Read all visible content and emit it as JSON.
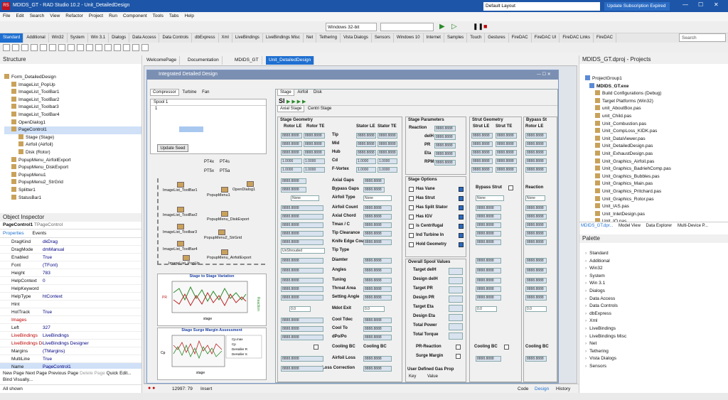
{
  "window": {
    "title": "MDIDS_GT - RAD Studio 10.2 - Unit_DetailedDesign",
    "layout": "Default Layout",
    "update": "Update Subscription Expired"
  },
  "menu": [
    "File",
    "Edit",
    "Search",
    "View",
    "Refactor",
    "Project",
    "Run",
    "Component",
    "Tools",
    "Tabs",
    "Help"
  ],
  "toolbar": {
    "platform": "Windows 32-bit",
    "search_placeholder": "Search"
  },
  "palette_tabs": [
    "Standard",
    "Additional",
    "Win32",
    "System",
    "Win 3.1",
    "Dialogs",
    "Data Access",
    "Data Controls",
    "dbExpress",
    "Xml",
    "LiveBindings",
    "LiveBindings Misc",
    "Net",
    "Tethering",
    "Vista Dialogs",
    "Sensors",
    "Windows 10",
    "Internet",
    "Samples",
    "Touch",
    "Gestures",
    "FireDAC",
    "FireDAC UI",
    "FireDAC Links",
    "FireDAC"
  ],
  "structure": {
    "title": "Structure",
    "items": [
      "Form_DetailedDesign",
      "ImageList_PopUp",
      "ImageList_ToolBar1",
      "ImageList_ToolBar2",
      "ImageList_Toolbar3",
      "ImageList_ToolBar4",
      "OpenDialog1",
      "PageControl1",
      "Stage (Stage)",
      "Airfoil (Airfoil)",
      "Disk (Rotor)",
      "PopupMenu_AirfoilExport",
      "PopupMenu_DiskExport",
      "PopupMenu1",
      "PopupMenu2_StrGrid",
      "Splitter1",
      "StatusBar1"
    ]
  },
  "object_inspector": {
    "title": "Object Inspector",
    "selected": "PageControl1",
    "selected_type": "TPageControl",
    "tabs": [
      "Properties",
      "Events"
    ],
    "rows": [
      [
        "DragKind",
        "dkDrag"
      ],
      [
        "DragMode",
        "dmManual"
      ],
      [
        "Enabled",
        "True"
      ],
      [
        "Font",
        "(TFont)"
      ],
      [
        "Height",
        "783"
      ],
      [
        "HelpContext",
        "0"
      ],
      [
        "HelpKeyword",
        ""
      ],
      [
        "HelpType",
        "htContext"
      ],
      [
        "Hint",
        ""
      ],
      [
        "HotTrack",
        "True"
      ],
      [
        "Images",
        ""
      ],
      [
        "Left",
        "327"
      ],
      [
        "LiveBindings",
        "LiveBindings"
      ],
      [
        "LiveBindings Des",
        "LiveBindings Designer"
      ],
      [
        "Margins",
        "(TMargins)"
      ],
      [
        "MultiLine",
        "True"
      ],
      [
        "Name",
        "PageControl1"
      ],
      [
        "OwnerDraw",
        "False"
      ]
    ],
    "links": [
      "New Page",
      "Next Page",
      "Previous Page",
      "Delete Page",
      "Quick Edit...",
      "Bind Visually..."
    ],
    "footer": "All shown"
  },
  "doc_tabs": [
    "WelcomePage",
    "Documentation",
    "MDIDS_GT",
    "Unit_DetailedDesign"
  ],
  "form": {
    "title": "Integrated Detailed Design",
    "left_tabs": [
      "Compressor",
      "Turbine",
      "Fan"
    ],
    "spool_tab": "Spool 1",
    "spool_cell": "1",
    "update_btn": "Update Seed",
    "pt_labels": [
      "PT4x",
      "PT4s",
      "PT5x",
      "PT5a"
    ],
    "components": [
      "ImageList_ToolBar1",
      "PopupMenu1",
      "OpenDialog1",
      "ImageList_ToolBar2",
      "PopupMenu_DiskExport",
      "ImageList_Toolbar3",
      "PopupMenu2_StrGrid",
      "ImageList_ToolBar4",
      "PopupMenu_AirfoilExport",
      "ImageList_PopUp"
    ],
    "chart1": {
      "title": "Stage to Stage Variation",
      "xlabel": "stage",
      "ylabel": "PR",
      "y2label": "Reaction"
    },
    "chart2": {
      "title": "Stage Surge Margin Assessment",
      "xlabel": "stage",
      "ylabel": "Cp",
      "legend": [
        "Cp.max",
        "Cp",
        "DeHaller R",
        "DeHaller S"
      ]
    },
    "stage_tabs": [
      "Stage",
      "Airfoil",
      "Disk"
    ],
    "sub_tabs": [
      "Axial Stage",
      "Centri Stage"
    ],
    "stage_geometry": {
      "title": "Stage Geometry",
      "cols": [
        "Rotor LE",
        "Rotor TE",
        "Stator LE",
        "Stator TE"
      ],
      "rows": [
        "Tip",
        "Mid",
        "Hub",
        "Cd",
        "F-Vortex",
        "Axial Gaps",
        "Bypass Gaps",
        "Airfoil Type",
        "Airfoil Count",
        "Axial Chord",
        "Tmax / C",
        "Tip Clearance",
        "Knife Edge Count",
        "Tip Type",
        "Diamter",
        "Angles",
        "Tuning",
        "Throat Area",
        "Setting Angle",
        "Mdot Exit",
        "Cool Tdec",
        "Cool To",
        "dPo/Po",
        "Cooling BC",
        "Airfoil Loss",
        "Loss Correction"
      ],
      "val": "8888.8888",
      "val1": "1.0000",
      "none": "None",
      "unshrouded": "UnShrouded",
      "zero": "0.0",
      "cool_bc": "Cooling BC"
    },
    "stage_params": {
      "title": "Stage Parameters",
      "rows": [
        "Reaction",
        "delH",
        "PR",
        "Eta",
        "RPM"
      ]
    },
    "stage_options": {
      "title": "Stage Options",
      "rows": [
        "Has Vane",
        "Has Strut",
        "Has Split Stator",
        "Has IGV",
        "is Centrifugal",
        "Ind Turbine In",
        "Hold Geometry"
      ]
    },
    "overall": {
      "title": "Overall Spool Values",
      "rows": [
        "Target delH",
        "Design delH",
        "Target PR",
        "Design PR",
        "Target Eta",
        "Design Eta",
        "Total Power",
        "Total Torque",
        "PR-Reaction",
        "Surge Margin"
      ],
      "gas": "User Defined Gas Prop",
      "key": "Key",
      "value": "Value"
    },
    "strut": {
      "title": "Strut Geometry",
      "cols": [
        "Strut LE",
        "Strut TE"
      ],
      "bypass": "Bypass Strut"
    },
    "bypass": {
      "title": "Bypass St",
      "cols": [
        "Rotor LE"
      ],
      "reaction": "Reaction"
    }
  },
  "projects": {
    "title": "MDIDS_GT.dproj - Projects",
    "items": [
      "ProjectGroup1",
      "MDIDS_GT.exe",
      "Build Configurations (Debug)",
      "Target Platforms (Win32)",
      "unit_AboutBox.pas",
      "unit_Child.pas",
      "Unit_Combustion.pas",
      "Unit_CompLoss_KIDK.pas",
      "Unit_DataViewer.pas",
      "Unit_DetailedDesign.pas",
      "Unit_ExhaustDesign.pas",
      "Unit_Graphics_Airfoil.pas",
      "Unit_Graphics_BadriehComp.pas",
      "Unit_Graphics_Bubbles.pas",
      "Unit_Graphics_Main.pas",
      "Unit_Graphics_Pritchard.pas",
      "Unit_Graphics_Rotor.pas",
      "Unit_IAS.pas",
      "Unit_InletDesign.pas",
      "Unit_IO.pas"
    ],
    "tabs": [
      "MDIDS_GT.dpr...",
      "Model View",
      "Data Explorer",
      "Multi-Device P..."
    ]
  },
  "palette": {
    "title": "Palette",
    "items": [
      "Standard",
      "Additional",
      "Win32",
      "System",
      "Win 3.1",
      "Dialogs",
      "Data Access",
      "Data Controls",
      "dbExpress",
      "Xml",
      "LiveBindings",
      "LiveBindings Misc",
      "Net",
      "Tethering",
      "Vista Dialogs",
      "Sensors",
      "Windows 10"
    ]
  },
  "status": {
    "pos": "12997: 79",
    "mode": "Insert",
    "tabs": [
      "Code",
      "Design",
      "History"
    ]
  }
}
